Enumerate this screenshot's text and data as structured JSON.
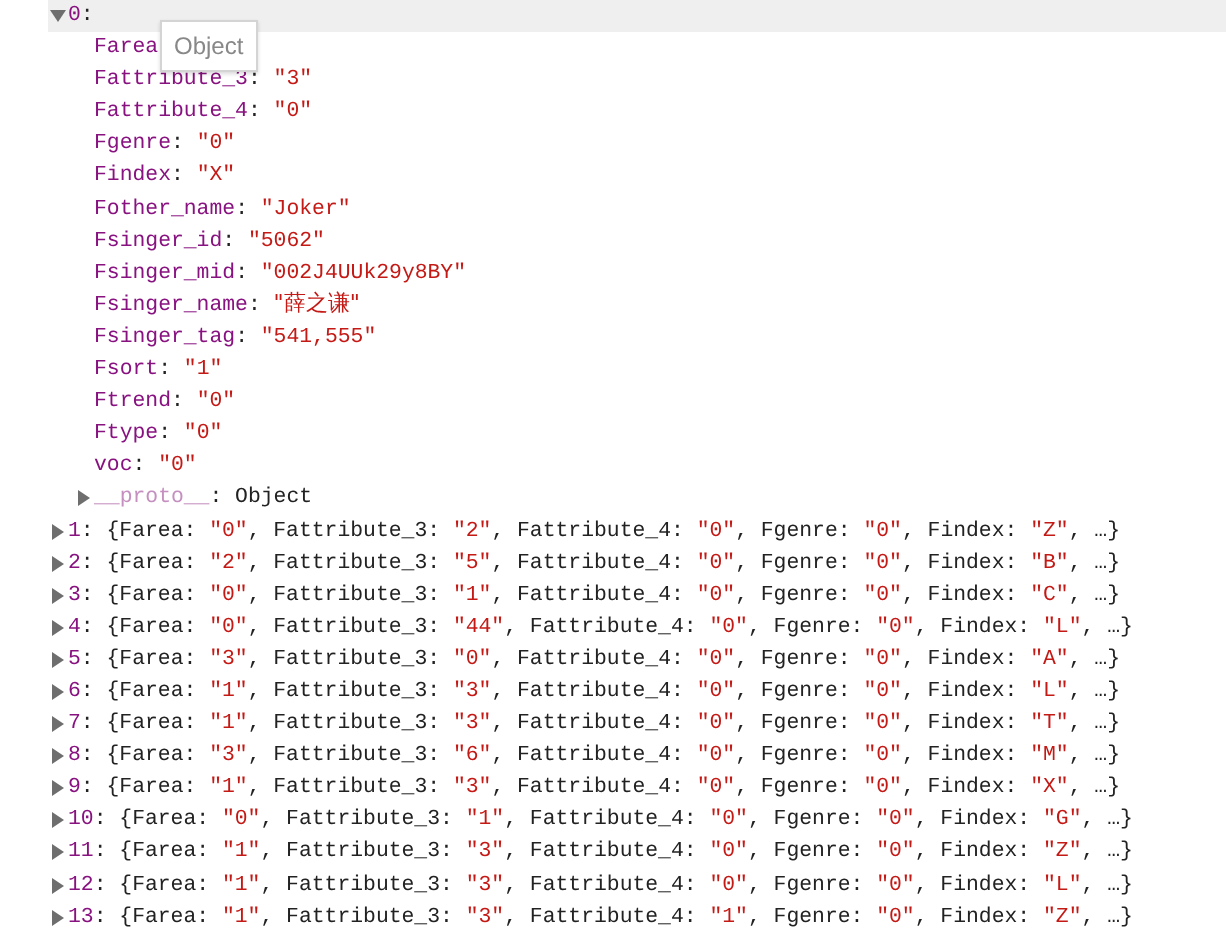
{
  "items": [
    {
      "label": "0:",
      "expanded": true,
      "properties": [
        "Farea:",
        "Fattribute_3: \"3\"",
        "Fattribute_4: \"0\"",
        "Fgenre: \"0\"",
        "Findex: \"X\"",
        "Fother_name: \"Joker\"",
        "Fsinger_id: \"5062\"",
        "Fsinger_mid: \"002J4UUk29y8BY\"",
        "Fsinger_name: \"薛之谦\"",
        "Fsinger_tag: \"541,555\"",
        "Fsort: \"1\"",
        "Ftrend: \"0\"",
        "Ftype: \"0\"",
        "voc: \"0\""
      ],
      "proto": {
        "label": "__proto__: Object",
        "expanded": false
      }
    },
    {
      "label": "1: {Farea: \"0\", Fattribute_3: \"2\", Fattribute_4: \"0\", Fgenre: \"0\", Findex: \"Z\", …}",
      "expanded": false
    },
    {
      "label": "2: {Farea: \"2\", Fattribute_3: \"5\", Fattribute_4: \"0\", Fgenre: \"0\", Findex: \"B\", …}",
      "expanded": false
    },
    {
      "label": "3: {Farea: \"0\", Fattribute_3: \"1\", Fattribute_4: \"0\", Fgenre: \"0\", Findex: \"C\", …}",
      "expanded": false
    },
    {
      "label": "4: {Farea: \"0\", Fattribute_3: \"44\", Fattribute_4: \"0\", Fgenre: \"0\", Findex: \"L\", …}",
      "expanded": false
    },
    {
      "label": "5: {Farea: \"3\", Fattribute_3: \"0\", Fattribute_4: \"0\", Fgenre: \"0\", Findex: \"A\", …}",
      "expanded": false
    },
    {
      "label": "6: {Farea: \"1\", Fattribute_3: \"3\", Fattribute_4: \"0\", Fgenre: \"0\", Findex: \"L\", …}",
      "expanded": false
    },
    {
      "label": "7: {Farea: \"1\", Fattribute_3: \"3\", Fattribute_4: \"0\", Fgenre: \"0\", Findex: \"T\", …}",
      "expanded": false
    },
    {
      "label": "8: {Farea: \"3\", Fattribute_3: \"6\", Fattribute_4: \"0\", Fgenre: \"0\", Findex: \"M\", …}",
      "expanded": false
    },
    {
      "label": "9: {Farea: \"1\", Fattribute_3: \"3\", Fattribute_4: \"0\", Fgenre: \"0\", Findex: \"X\", …}",
      "expanded": false
    },
    {
      "label": "10: {Farea: \"0\", Fattribute_3: \"1\", Fattribute_4: \"0\", Fgenre: \"0\", Findex: \"G\", …}",
      "expanded": false
    },
    {
      "label": "11: {Farea: \"1\", Fattribute_3: \"3\", Fattribute_4: \"0\", Fgenre: \"0\", Findex: \"Z\", …}",
      "expanded": false
    },
    {
      "label": "12: {Farea: \"1\", Fattribute_3: \"3\", Fattribute_4: \"0\", Fgenre: \"0\", Findex: \"L\", …}",
      "expanded": false
    },
    {
      "label": "13: {Farea: \"1\", Fattribute_3: \"3\", Fattribute_4: \"1\", Fgenre: \"0\", Findex: \"Z\", …}",
      "expanded": false
    }
  ],
  "tooltip": {
    "text": "Object"
  }
}
